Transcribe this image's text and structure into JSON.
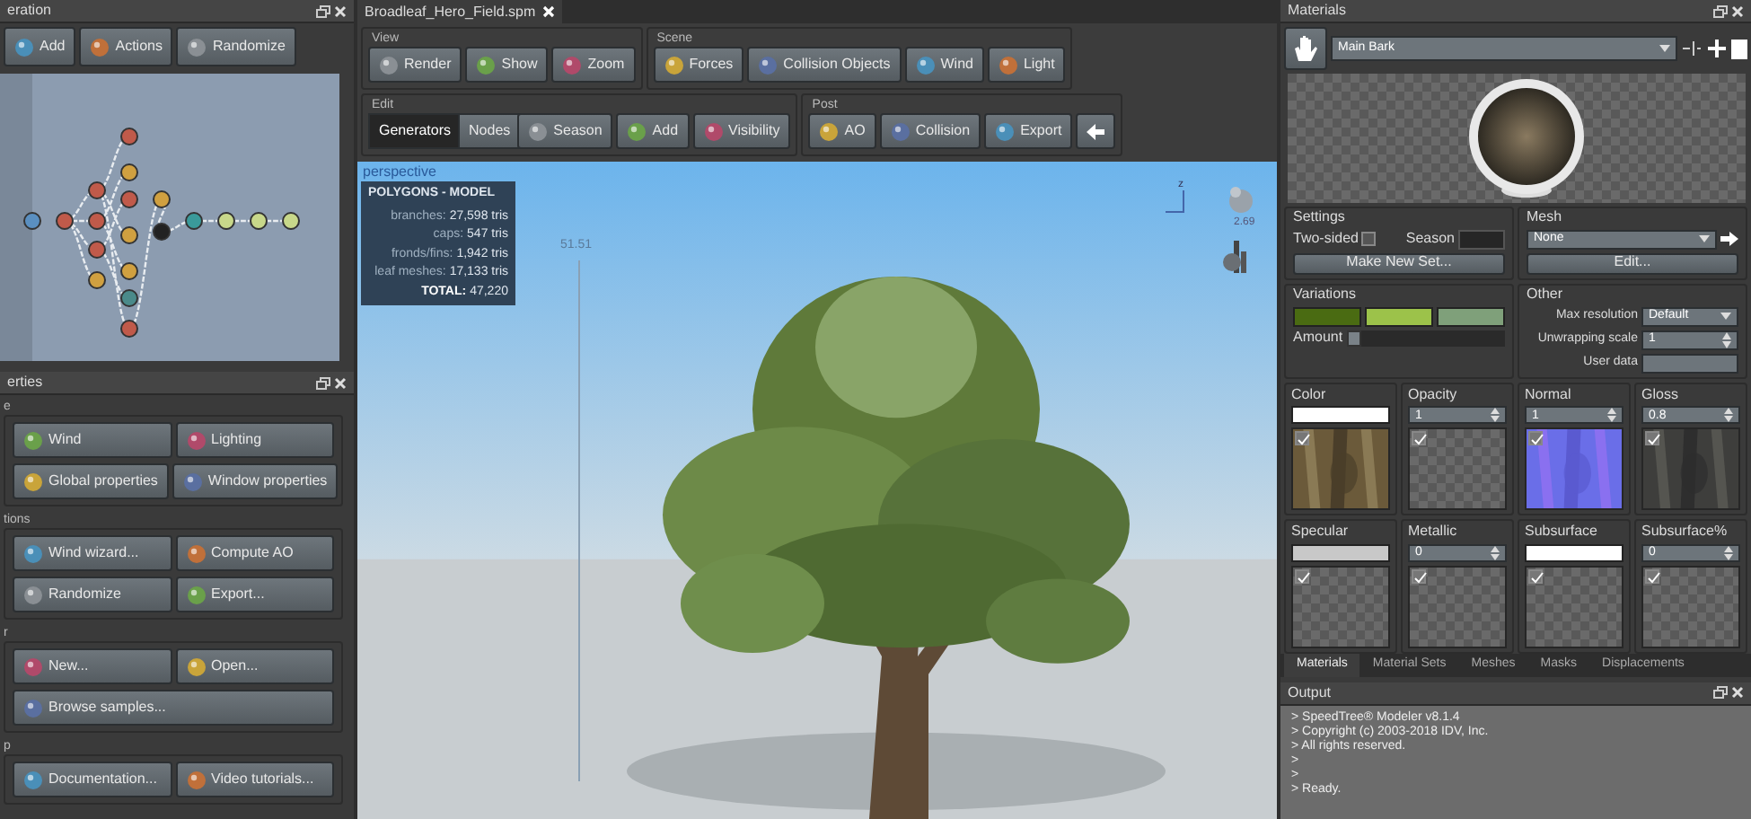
{
  "generation_panel": {
    "title": "eration",
    "toolbar": [
      "Add",
      "Actions",
      "Randomize"
    ]
  },
  "properties_panel": {
    "title": "erties",
    "groups": [
      {
        "title": "e",
        "buttons": [
          [
            "Wind",
            "Lighting"
          ],
          [
            "Global properties",
            "Window properties"
          ]
        ]
      },
      {
        "title": "tions",
        "buttons": [
          [
            "Wind wizard...",
            "Compute AO"
          ],
          [
            "Randomize",
            "Export..."
          ]
        ]
      },
      {
        "title": "r",
        "buttons": [
          [
            "New...",
            "Open..."
          ],
          [
            "Browse samples..."
          ]
        ]
      },
      {
        "title": "p",
        "buttons": [
          [
            "Documentation...",
            "Video tutorials..."
          ]
        ]
      }
    ]
  },
  "document_tab": {
    "title": "Broadleaf_Hero_Field.spm"
  },
  "toolbar_rows": [
    [
      {
        "title": "View",
        "buttons": [
          {
            "kind": "button",
            "label": "Render"
          },
          {
            "kind": "button",
            "label": "Show"
          },
          {
            "kind": "button",
            "label": "Zoom"
          }
        ]
      },
      {
        "title": "Scene",
        "buttons": [
          {
            "kind": "button",
            "label": "Forces"
          },
          {
            "kind": "button",
            "label": "Collision Objects"
          },
          {
            "kind": "button",
            "label": "Wind"
          },
          {
            "kind": "button",
            "label": "Light"
          }
        ]
      }
    ],
    [
      {
        "title": "Edit",
        "buttons": [
          {
            "kind": "segment",
            "label": "Generators",
            "selected": true
          },
          {
            "kind": "segment",
            "label": "Nodes",
            "selected": false
          },
          {
            "kind": "button",
            "label": "Season"
          },
          {
            "kind": "button",
            "label": "Add"
          },
          {
            "kind": "button",
            "label": "Visibility"
          }
        ]
      },
      {
        "title": "Post",
        "buttons": [
          {
            "kind": "button",
            "label": "AO"
          },
          {
            "kind": "button",
            "label": "Collision"
          },
          {
            "kind": "button",
            "label": "Export"
          },
          {
            "kind": "icon"
          }
        ]
      }
    ]
  ],
  "viewport": {
    "label": "perspective",
    "height_marker": "51.51",
    "axis_label": "z",
    "zoom_reading": "2.69",
    "stats": {
      "title": "POLYGONS - MODEL",
      "rows": [
        {
          "name": "branches:",
          "value": "27,598 tris"
        },
        {
          "name": "caps:",
          "value": "547 tris"
        },
        {
          "name": "fronds/fins:",
          "value": "1,942 tris"
        },
        {
          "name": "leaf meshes:",
          "value": "17,133 tris"
        },
        {
          "name": "TOTAL:",
          "value": "47,220"
        }
      ]
    }
  },
  "materials": {
    "title": "Materials",
    "material": "Main Bark",
    "settings": {
      "title": "Settings",
      "two_sided": {
        "label": "Two-sided",
        "checked": false
      },
      "season_label": "Season",
      "button": "Make New Set..."
    },
    "mesh": {
      "title": "Mesh",
      "value": "None",
      "button": "Edit..."
    },
    "variations": {
      "title": "Variations",
      "swatches": [
        {
          "color": "#4a6b12"
        },
        {
          "color": "#9cc24a"
        },
        {
          "color": "#7fa07a"
        }
      ],
      "amount": {
        "label": "Amount",
        "level": 0
      }
    },
    "other": {
      "title": "Other",
      "fields": [
        {
          "kind": "dropdown",
          "label": "Max resolution",
          "value": "Default"
        },
        {
          "kind": "spinner",
          "label": "Unwrapping scale",
          "value": "1"
        },
        {
          "kind": "text",
          "label": "User data"
        }
      ]
    },
    "maps": [
      {
        "name": "Color",
        "kind": "swatch",
        "color": "#ffffff",
        "checked": true,
        "textured": true
      },
      {
        "name": "Opacity",
        "kind": "number",
        "value": "1",
        "checked": true,
        "textured": false
      },
      {
        "name": "Normal",
        "kind": "number",
        "value": "1",
        "checked": true,
        "textured": true
      },
      {
        "name": "Gloss",
        "kind": "number",
        "value": "0.8",
        "checked": true,
        "textured": true
      },
      {
        "name": "Specular",
        "kind": "swatch",
        "color": "#c8c8c8",
        "checked": true,
        "textured": false
      },
      {
        "name": "Metallic",
        "kind": "number",
        "value": "0",
        "checked": true,
        "textured": false
      },
      {
        "name": "Subsurface",
        "kind": "swatch",
        "color": "#ffffff",
        "checked": true,
        "textured": false
      },
      {
        "name": "Subsurface%",
        "kind": "number",
        "value": "0",
        "checked": true,
        "textured": false
      }
    ],
    "tabs": [
      {
        "label": "Materials",
        "selected": true
      },
      {
        "label": "Material Sets",
        "selected": false
      },
      {
        "label": "Meshes",
        "selected": false
      },
      {
        "label": "Masks",
        "selected": false
      },
      {
        "label": "Displacements",
        "selected": false
      }
    ]
  },
  "output": {
    "title": "Output",
    "lines": [
      "> SpeedTree® Modeler v8.1.4",
      "> Copyright (c) 2003-2018 IDV, Inc.",
      "> All rights reserved.",
      ">",
      ">",
      "> Ready."
    ]
  }
}
